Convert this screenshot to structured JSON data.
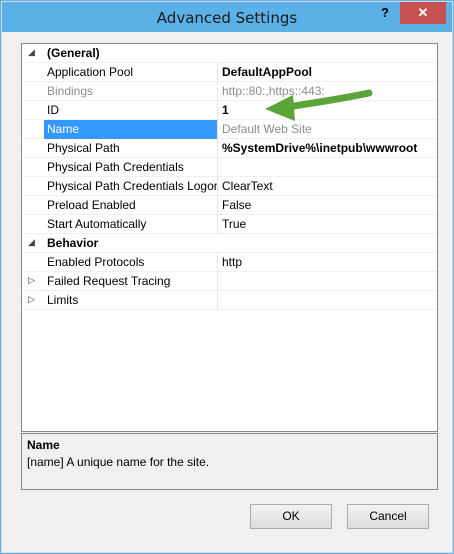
{
  "window": {
    "title": "Advanced Settings",
    "help_glyph": "?",
    "close_glyph": "✕"
  },
  "properties": {
    "general_category": "(General)",
    "application_pool": {
      "label": "Application Pool",
      "value": "DefaultAppPool"
    },
    "bindings": {
      "label": "Bindings",
      "value": "http::80:,https::443:"
    },
    "id": {
      "label": "ID",
      "value": "1"
    },
    "name": {
      "label": "Name",
      "value": "Default Web Site"
    },
    "physical_path": {
      "label": "Physical Path",
      "value": "%SystemDrive%\\inetpub\\wwwroot"
    },
    "physical_path_credentials": {
      "label": "Physical Path Credentials",
      "value": ""
    },
    "physical_path_credentials_logon": {
      "label": "Physical Path Credentials Logon",
      "value": "ClearText"
    },
    "preload_enabled": {
      "label": "Preload Enabled",
      "value": "False"
    },
    "start_automatically": {
      "label": "Start Automatically",
      "value": "True"
    },
    "behavior_category": "Behavior",
    "enabled_protocols": {
      "label": "Enabled Protocols",
      "value": "http"
    },
    "failed_request_tracing": {
      "label": "Failed Request Tracing",
      "value": ""
    },
    "limits": {
      "label": "Limits",
      "value": ""
    }
  },
  "description": {
    "title": "Name",
    "text": "[name] A unique name for the site."
  },
  "buttons": {
    "ok": "OK",
    "cancel": "Cancel"
  },
  "colors": {
    "titlebar": "#5bb0e6",
    "close": "#c75050",
    "selection": "#3399ff",
    "arrow": "#5aa43a"
  },
  "icons": {
    "expanded": "triangle-down-icon",
    "collapsed": "triangle-right-icon"
  }
}
